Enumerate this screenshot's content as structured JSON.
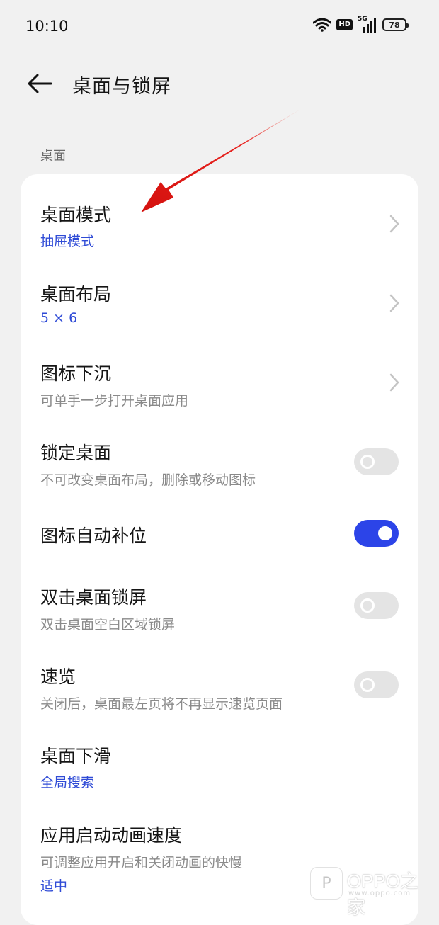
{
  "status_bar": {
    "time": "10:10",
    "hd_label": "HD",
    "signal_label": "5G",
    "battery": "78"
  },
  "header": {
    "title": "桌面与锁屏"
  },
  "section": {
    "label": "桌面"
  },
  "settings": [
    {
      "title": "桌面模式",
      "value": "抽屉模式",
      "control": "chevron"
    },
    {
      "title": "桌面布局",
      "value": "5 × 6",
      "control": "chevron"
    },
    {
      "title": "图标下沉",
      "subtitle": "可单手一步打开桌面应用",
      "control": "chevron"
    },
    {
      "title": "锁定桌面",
      "subtitle": "不可改变桌面布局，删除或移动图标",
      "control": "toggle",
      "on": false
    },
    {
      "title": "图标自动补位",
      "control": "toggle",
      "on": true
    },
    {
      "title": "双击桌面锁屏",
      "subtitle": "双击桌面空白区域锁屏",
      "control": "toggle",
      "on": false
    },
    {
      "title": "速览",
      "subtitle": "关闭后，桌面最左页将不再显示速览页面",
      "control": "toggle",
      "on": false
    },
    {
      "title": "桌面下滑",
      "value": "全局搜索"
    },
    {
      "title": "应用启动动画速度",
      "subtitle": "可调整应用开启和关闭动画的快慢",
      "value": "适中"
    }
  ],
  "watermark": {
    "brand": "OPPO之家",
    "url": "www.oppo.com"
  },
  "colors": {
    "accent": "#2c44e8",
    "value_text": "#2f4bd6",
    "annotation_arrow": "#e8231f",
    "background": "#f1f1f1",
    "card": "#ffffff"
  },
  "icons": {
    "back": "arrow-left-icon",
    "chevron": "chevron-right-icon",
    "wifi": "wifi-icon",
    "battery": "battery-icon"
  }
}
